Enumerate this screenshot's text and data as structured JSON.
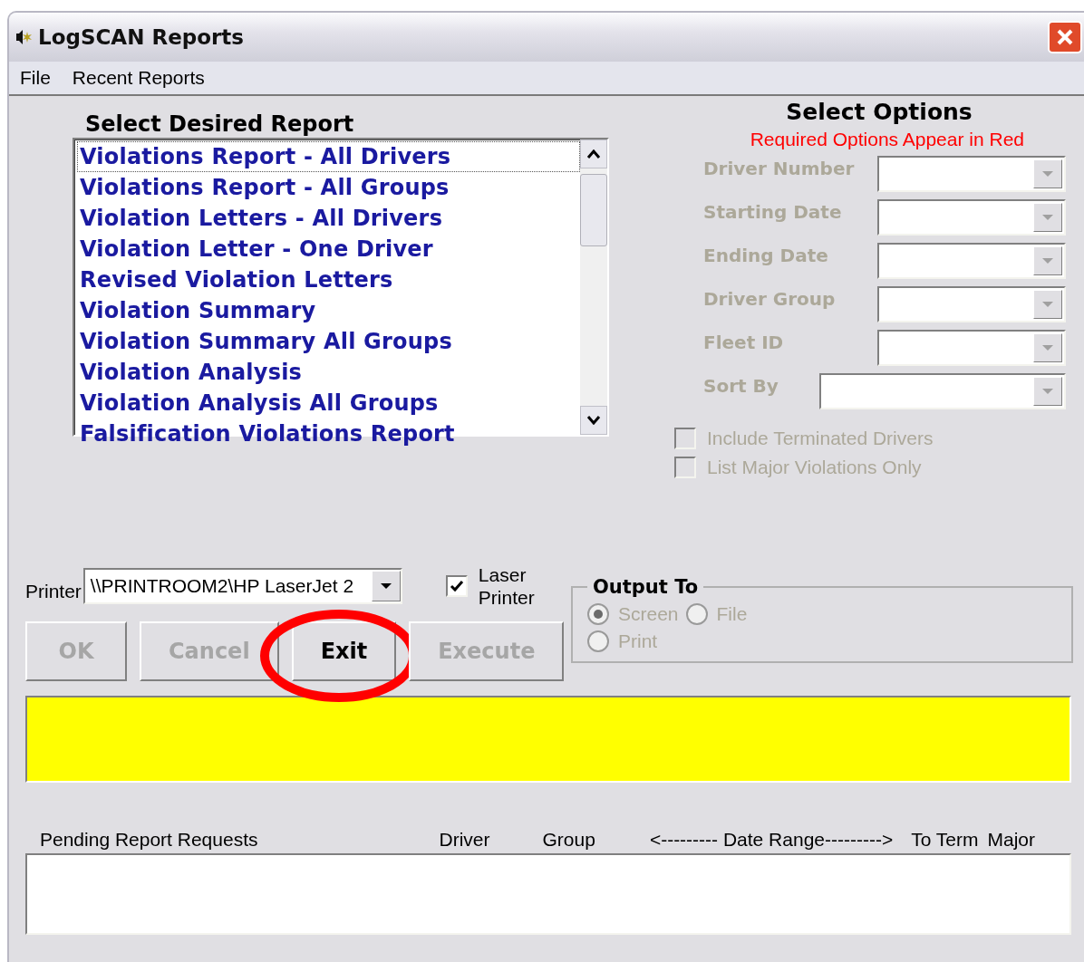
{
  "window": {
    "title": "LogSCAN Reports"
  },
  "menu": [
    {
      "label": "File"
    },
    {
      "label": "Recent Reports"
    }
  ],
  "report_list": {
    "heading": "Select Desired Report",
    "items": [
      {
        "label": "Violations Report - All Drivers",
        "selected": true
      },
      {
        "label": "Violations Report - All Groups",
        "selected": false
      },
      {
        "label": "Violation Letters - All Drivers",
        "selected": false
      },
      {
        "label": "Violation Letter - One Driver",
        "selected": false
      },
      {
        "label": "Revised Violation Letters",
        "selected": false
      },
      {
        "label": "Violation Summary",
        "selected": false
      },
      {
        "label": "Violation Summary All Groups",
        "selected": false
      },
      {
        "label": "Violation Analysis",
        "selected": false
      },
      {
        "label": "Violation Analysis All Groups",
        "selected": false
      },
      {
        "label": "Falsification Violations Report",
        "selected": false
      }
    ]
  },
  "options": {
    "heading": "Select Options",
    "note": "Required Options Appear in Red",
    "fields": [
      {
        "label": "Driver Number",
        "disabled": true
      },
      {
        "label": "Starting Date",
        "disabled": true
      },
      {
        "label": "Ending Date",
        "disabled": true
      },
      {
        "label": "Driver Group",
        "disabled": true
      },
      {
        "label": "Fleet ID",
        "disabled": true
      },
      {
        "label": "Sort By",
        "disabled": true
      }
    ],
    "checkboxes": [
      {
        "label": "Include Terminated Drivers",
        "checked": false,
        "disabled": true
      },
      {
        "label": "List Major Violations Only",
        "checked": false,
        "disabled": true
      }
    ]
  },
  "printer": {
    "label": "Printer",
    "value": "\\\\PRINTROOM2\\HP LaserJet 2",
    "laser_label": "Laser Printer",
    "laser_checked": true
  },
  "buttons": [
    {
      "label": "OK",
      "disabled": true,
      "circled": false
    },
    {
      "label": "Cancel",
      "disabled": true,
      "circled": false
    },
    {
      "label": "Exit",
      "disabled": false,
      "circled": true
    },
    {
      "label": "Execute",
      "disabled": true,
      "circled": false
    }
  ],
  "output_to": {
    "title": "Output To",
    "options": [
      {
        "label": "Screen",
        "selected": true,
        "disabled": true
      },
      {
        "label": "File",
        "selected": false,
        "disabled": true
      },
      {
        "label": "Print",
        "selected": false,
        "disabled": true
      }
    ]
  },
  "pending": {
    "columns": [
      "Pending Report Requests",
      "Driver",
      "Group",
      "<--------- Date Range--------->",
      "To Term",
      "Major"
    ]
  }
}
